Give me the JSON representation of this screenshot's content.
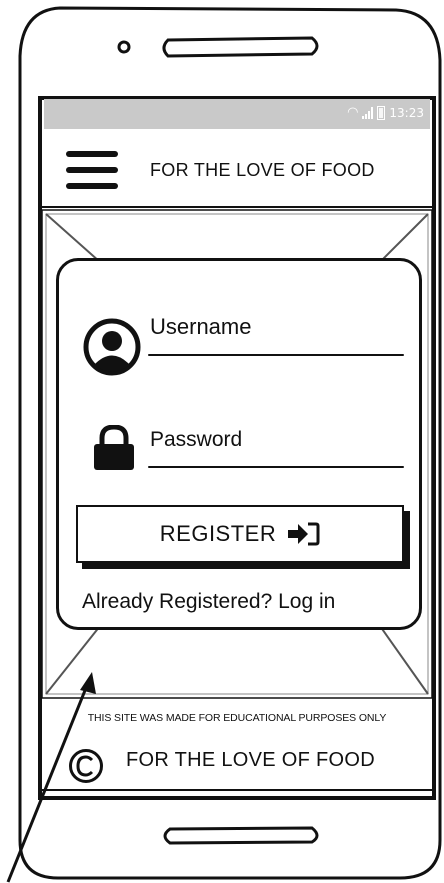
{
  "status_bar": {
    "time": "13:23"
  },
  "header": {
    "title": "FOR THE LOVE OF FOOD"
  },
  "login": {
    "username_label": "Username",
    "password_label": "Password",
    "register_label": "REGISTER",
    "login_link": "Already Registered? Log in"
  },
  "footer": {
    "note": "THIS SITE WAS MADE FOR EDUCATIONAL PURPOSES ONLY",
    "title": "FOR THE LOVE OF FOOD"
  },
  "icons": {
    "menu": "hamburger-icon",
    "user": "user-circle-icon",
    "lock": "lock-icon",
    "register": "sign-in-arrow-icon",
    "copyright": "copyright-icon"
  },
  "colors": {
    "ink": "#111111",
    "status_bar": "#c9c9c9",
    "background": "#ffffff"
  }
}
